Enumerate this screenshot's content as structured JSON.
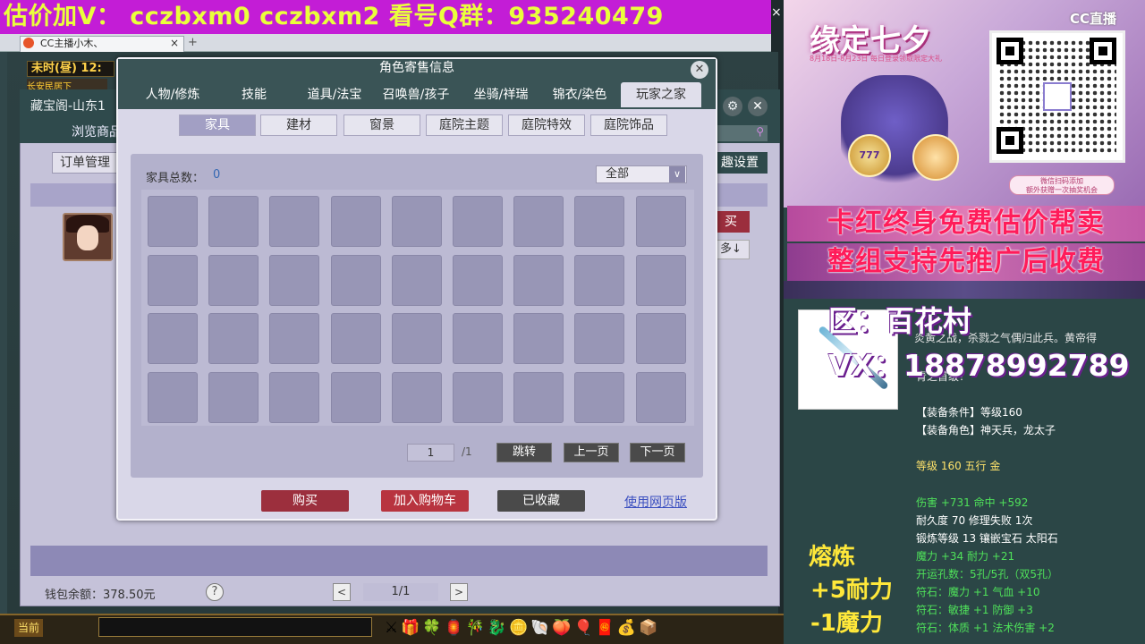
{
  "banner": {
    "text": "估价加V： cczbxm0   cczbxm2   看号Q群：935240479",
    "close": "×"
  },
  "browser": {
    "tab_title": "CC主播小木、",
    "tab_close": "×",
    "new_tab": "+"
  },
  "game": {
    "time_label": "未时(昼)",
    "time_value": "12:",
    "location_fragment": "长安民居下"
  },
  "store": {
    "title": "藏宝阁-山东1",
    "nav_browse": "浏览商品",
    "gear": "⚙",
    "close": "✕",
    "search_glyph": "⚲",
    "order_button": "订单管理",
    "settings_button": "趣设置",
    "buy_button": "买",
    "sort_button": "多↓",
    "wallet_label": "钱包余额：",
    "wallet_value": "378.50元",
    "help": "?",
    "page_prev": "<",
    "page_label": "1/1",
    "page_next": ">"
  },
  "dialog": {
    "title": "角色寄售信息",
    "close": "✕",
    "tabs": [
      "人物/修炼",
      "技能",
      "道具/法宝",
      "召唤兽/孩子",
      "坐骑/祥瑞",
      "锦衣/染色",
      "玩家之家"
    ],
    "active_tab": 6,
    "subtabs": [
      "家具",
      "建材",
      "窗景",
      "庭院主题",
      "庭院特效",
      "庭院饰品"
    ],
    "active_subtab": 0,
    "total_label": "家具总数：",
    "total_value": "0",
    "filter_value": "全部",
    "filter_chevron": "∨",
    "grid_rows": 4,
    "grid_cols": 9,
    "page_current": "1",
    "page_total": "/1",
    "jump_button": "跳转",
    "prev_button": "上一页",
    "next_button": "下一页",
    "buy_button": "购买",
    "cart_button": "加入购物车",
    "favorite_button": "已收藏",
    "web_link": "使用网页版"
  },
  "taskbar": {
    "current_label": "当前",
    "icons": "⚔🎁🍀🏮🎋🐉🪙🐚🍑🎈🧧💰📦"
  },
  "overlay": {
    "promo_title": "缘定七夕",
    "promo_sub": "8月18日-8月23日  每日登录领取限定大礼",
    "promo_badge": "777",
    "promo_event": "微信扫码添加\n额外获赠一次抽奖机会",
    "cc_logo": "CC直播",
    "ad_line1": "卡红终身免费估价帮卖",
    "ad_line2": "整组支持先推广后收费",
    "region": "区：百花村",
    "vx": "VX：18878992789",
    "desc1": "炎黄之战，杀戮之气偶归此兵。黄帝得",
    "desc2": "青之首级！",
    "stats": [
      {
        "text": "【装备条件】等级160",
        "color": "#ffffff"
      },
      {
        "text": "【装备角色】神天兵，龙太子",
        "color": "#ffffff"
      },
      {
        "text": "",
        "color": "#ffffff"
      },
      {
        "text": "等级 160  五行 金",
        "color": "#ffe36b"
      },
      {
        "text": "",
        "color": "#ffffff"
      },
      {
        "text": "伤害 +731  命中 +592",
        "color": "#4fe15a"
      },
      {
        "text": "耐久度 70  修理失败 1次",
        "color": "#ffffff"
      },
      {
        "text": "锻炼等级 13  镶嵌宝石 太阳石",
        "color": "#ffffff"
      },
      {
        "text": "魔力 +34  耐力 +21",
        "color": "#4fe15a"
      },
      {
        "text": "开运孔数：5孔/5孔（双5孔）",
        "color": "#4fe15a"
      },
      {
        "text": "符石：魔力 +1  气血 +10",
        "color": "#4fe15a"
      },
      {
        "text": "符石：敏捷 +1  防御 +3",
        "color": "#4fe15a"
      },
      {
        "text": "符石：体质 +1  法术伤害 +2",
        "color": "#4fe15a"
      }
    ],
    "smelt_title": "熔炼",
    "smelt_line1": "+5耐力",
    "smelt_line2": "-1魔力"
  }
}
